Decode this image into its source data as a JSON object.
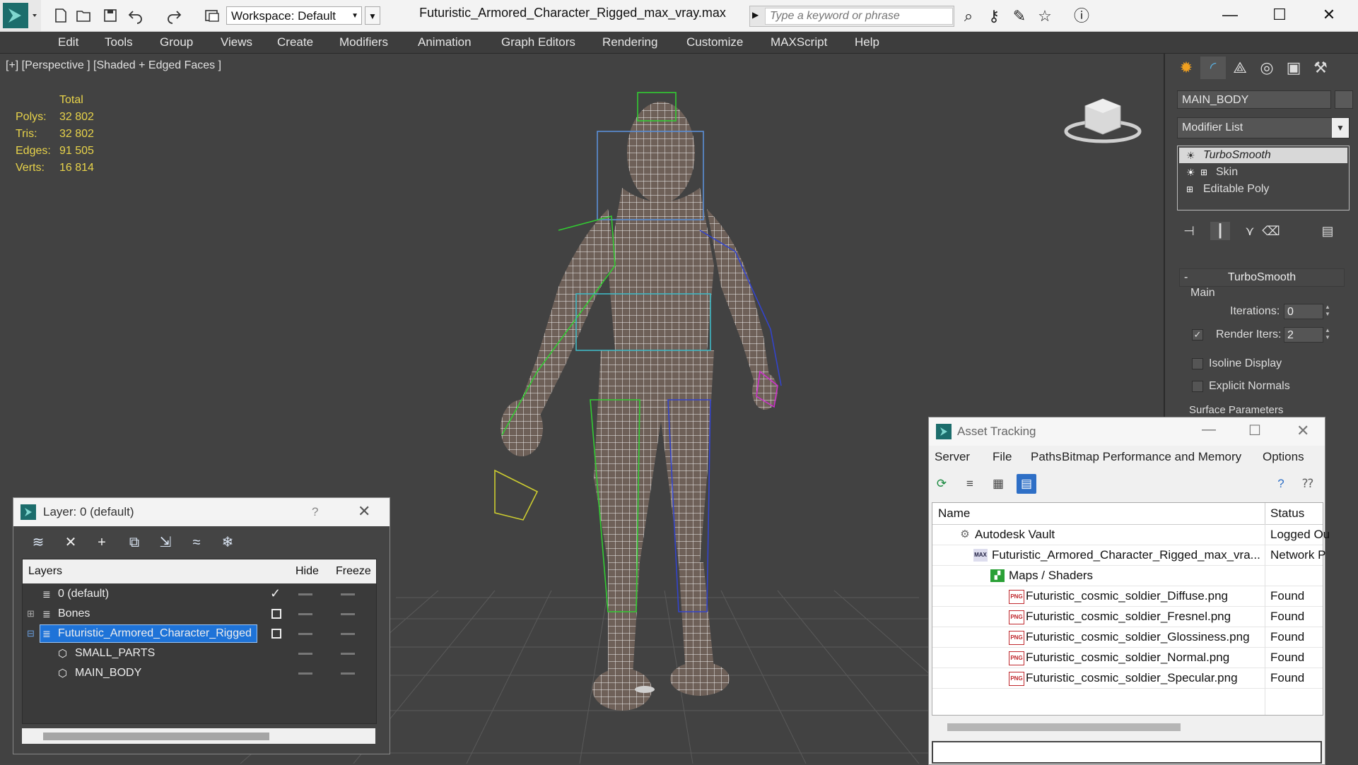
{
  "app": {
    "document_title": "Futuristic_Armored_Character_Rigged_max_vray.max",
    "workspace_label": "Workspace: Default",
    "search_placeholder": "Type a keyword or phrase"
  },
  "menubar": {
    "items": [
      "Edit",
      "Tools",
      "Group",
      "Views",
      "Create",
      "Modifiers",
      "Animation",
      "Graph Editors",
      "Rendering",
      "Customize",
      "MAXScript",
      "Help"
    ]
  },
  "viewport": {
    "label": "[+] [Perspective ] [Shaded + Edged Faces ]",
    "stats": {
      "header": "Total",
      "rows": [
        {
          "label": "Polys:",
          "value": "32 802"
        },
        {
          "label": "Tris:",
          "value": "32 802"
        },
        {
          "label": "Edges:",
          "value": "91 505"
        },
        {
          "label": "Verts:",
          "value": "16 814"
        }
      ]
    }
  },
  "command_panel": {
    "object_name": "MAIN_BODY",
    "modifier_list_label": "Modifier List",
    "stack": [
      {
        "label": "TurboSmooth",
        "selected": true
      },
      {
        "label": "Skin",
        "selected": false
      },
      {
        "label": "Editable Poly",
        "selected": false
      }
    ],
    "rollout": {
      "title": "TurboSmooth",
      "group_main": "Main",
      "iterations_label": "Iterations:",
      "iterations_value": "0",
      "render_iters_label": "Render Iters:",
      "render_iters_value": "2",
      "isoline_label": "Isoline Display",
      "explicit_normals_label": "Explicit Normals",
      "surface_params_label": "Surface Parameters"
    }
  },
  "layer_dialog": {
    "title": "Layer: 0 (default)",
    "help": "?",
    "columns": {
      "layers": "Layers",
      "hide": "Hide",
      "freeze": "Freeze"
    },
    "rows": [
      {
        "name": "0 (default)",
        "level": 0,
        "current": true
      },
      {
        "name": "Bones",
        "level": 0,
        "expandable": true
      },
      {
        "name": "Futuristic_Armored_Character_Rigged",
        "level": 0,
        "expandable": true,
        "selected": true
      },
      {
        "name": "SMALL_PARTS",
        "level": 1
      },
      {
        "name": "MAIN_BODY",
        "level": 1
      }
    ]
  },
  "asset_tracking": {
    "title": "Asset Tracking",
    "menu": [
      "Server",
      "File",
      "Paths",
      "Bitmap Performance and Memory",
      "Options"
    ],
    "columns": {
      "name": "Name",
      "status": "Status"
    },
    "rows": [
      {
        "name": "Autodesk Vault",
        "status": "Logged Ou",
        "indent": 1,
        "icon": "vault-icon"
      },
      {
        "name": "Futuristic_Armored_Character_Rigged_max_vra...",
        "status": "Network P",
        "indent": 2,
        "icon": "max-file-icon"
      },
      {
        "name": "Maps / Shaders",
        "status": "",
        "indent": 3,
        "icon": "maps-icon"
      },
      {
        "name": "Futuristic_cosmic_soldier_Diffuse.png",
        "status": "Found",
        "indent": 4,
        "icon": "png-icon"
      },
      {
        "name": "Futuristic_cosmic_soldier_Fresnel.png",
        "status": "Found",
        "indent": 4,
        "icon": "png-icon"
      },
      {
        "name": "Futuristic_cosmic_soldier_Glossiness.png",
        "status": "Found",
        "indent": 4,
        "icon": "png-icon"
      },
      {
        "name": "Futuristic_cosmic_soldier_Normal.png",
        "status": "Found",
        "indent": 4,
        "icon": "png-icon"
      },
      {
        "name": "Futuristic_cosmic_soldier_Specular.png",
        "status": "Found",
        "indent": 4,
        "icon": "png-icon"
      }
    ]
  },
  "colors": {
    "stats_yellow": "#e8d34a",
    "selection_blue": "#1e73d8",
    "viewport_bg": "#424242",
    "png_red": "#c0282d"
  }
}
